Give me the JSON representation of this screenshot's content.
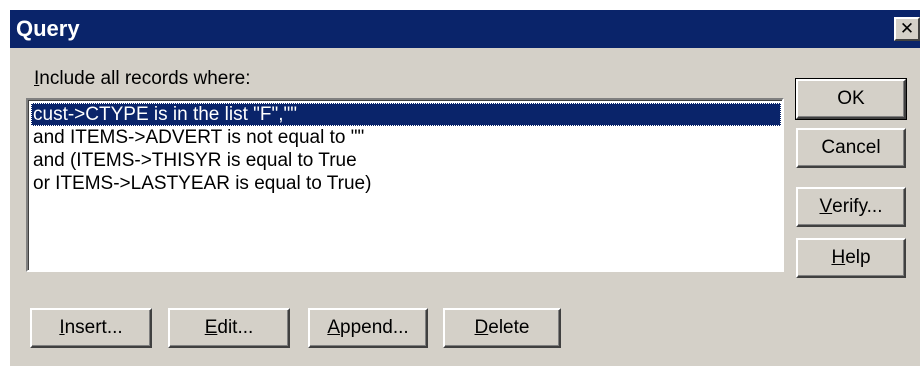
{
  "window": {
    "title": "Query",
    "close_glyph": "✕"
  },
  "label": {
    "prefix": "",
    "mnemonic": "I",
    "rest": "nclude all records where:"
  },
  "list": {
    "items": [
      "cust->CTYPE is in the list \"F\",\"\"",
      "and ITEMS->ADVERT is not equal to \"\"",
      "and (ITEMS->THISYR is equal to True",
      "or ITEMS->LASTYEAR is equal to True)"
    ],
    "selected_index": 0
  },
  "buttons": {
    "ok": {
      "pre": "",
      "mn": "",
      "post": "OK"
    },
    "cancel": {
      "pre": "",
      "mn": "",
      "post": "Cancel"
    },
    "verify": {
      "pre": "",
      "mn": "V",
      "post": "erify..."
    },
    "help": {
      "pre": "",
      "mn": "H",
      "post": "elp"
    },
    "insert": {
      "pre": "",
      "mn": "I",
      "post": "nsert..."
    },
    "edit": {
      "pre": "",
      "mn": "E",
      "post": "dit..."
    },
    "append": {
      "pre": "",
      "mn": "A",
      "post": "ppend..."
    },
    "delete": {
      "pre": "",
      "mn": "D",
      "post": "elete"
    }
  },
  "colors": {
    "titlebar": "#0a246a",
    "face": "#d4d0c8",
    "selection": "#0a246a"
  }
}
